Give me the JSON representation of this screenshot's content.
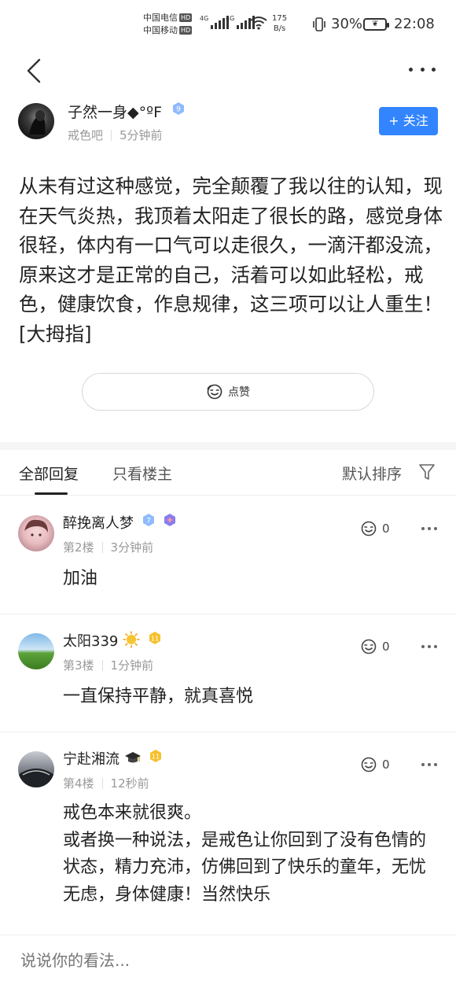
{
  "status_bar": {
    "carrier_1": "中国电信",
    "carrier_2": "中国移动",
    "hd": "HD",
    "net_1": "4G",
    "net_2": "4G",
    "speed_value": "175",
    "speed_unit": "B/s",
    "battery": "30%",
    "time": "22:08",
    "icons": [
      "signal-icon",
      "wifi-icon",
      "vibrate-icon",
      "battery-icon"
    ]
  },
  "nav": {
    "back_icon": "chevron-left-icon",
    "more_icon": "more-horizontal-icon"
  },
  "post": {
    "author": "子然一身◆°ºF",
    "level": "9",
    "forum": "戒色吧",
    "time": "5分钟前",
    "follow_label": "+ 关注",
    "body": "从未有过这种感觉，完全颠覆了我以往的认知，现在天气炎热，我顶着太阳走了很长的路，感觉身体很轻，体内有一口气可以走很久，一滴汗都没流，原来这才是正常的自己，活着可以如此轻松，戒色，健康饮食，作息规律，这三项可以让人重生！[大拇指]",
    "like_label": "点赞"
  },
  "tabs": {
    "all": "全部回复",
    "owner_only": "只看楼主",
    "sort": "默认排序"
  },
  "comments": [
    {
      "name": "醉挽离人梦",
      "level": "7",
      "floor": "第2楼",
      "time": "3分钟前",
      "likes": "0",
      "text": "加油"
    },
    {
      "name": "太阳339",
      "level": "11",
      "floor": "第3楼",
      "time": "1分钟前",
      "likes": "0",
      "text": "一直保持平静，就真喜悦"
    },
    {
      "name": "宁赴湘流",
      "level": "11",
      "floor": "第4楼",
      "time": "12秒前",
      "likes": "0",
      "text_lines": [
        "戒色本来就很爽。",
        "或者换一种说法，是戒色让你回到了没有色情的状态，精力充沛，仿佛回到了快乐的童年，无忧无虑，身体健康！当然快乐"
      ]
    }
  ],
  "reply": {
    "placeholder": "说说你的看法..."
  },
  "colors": {
    "accent": "#3385ff",
    "badge_blue": "#6aa5ff",
    "badge_gold": "#f5c02b"
  }
}
